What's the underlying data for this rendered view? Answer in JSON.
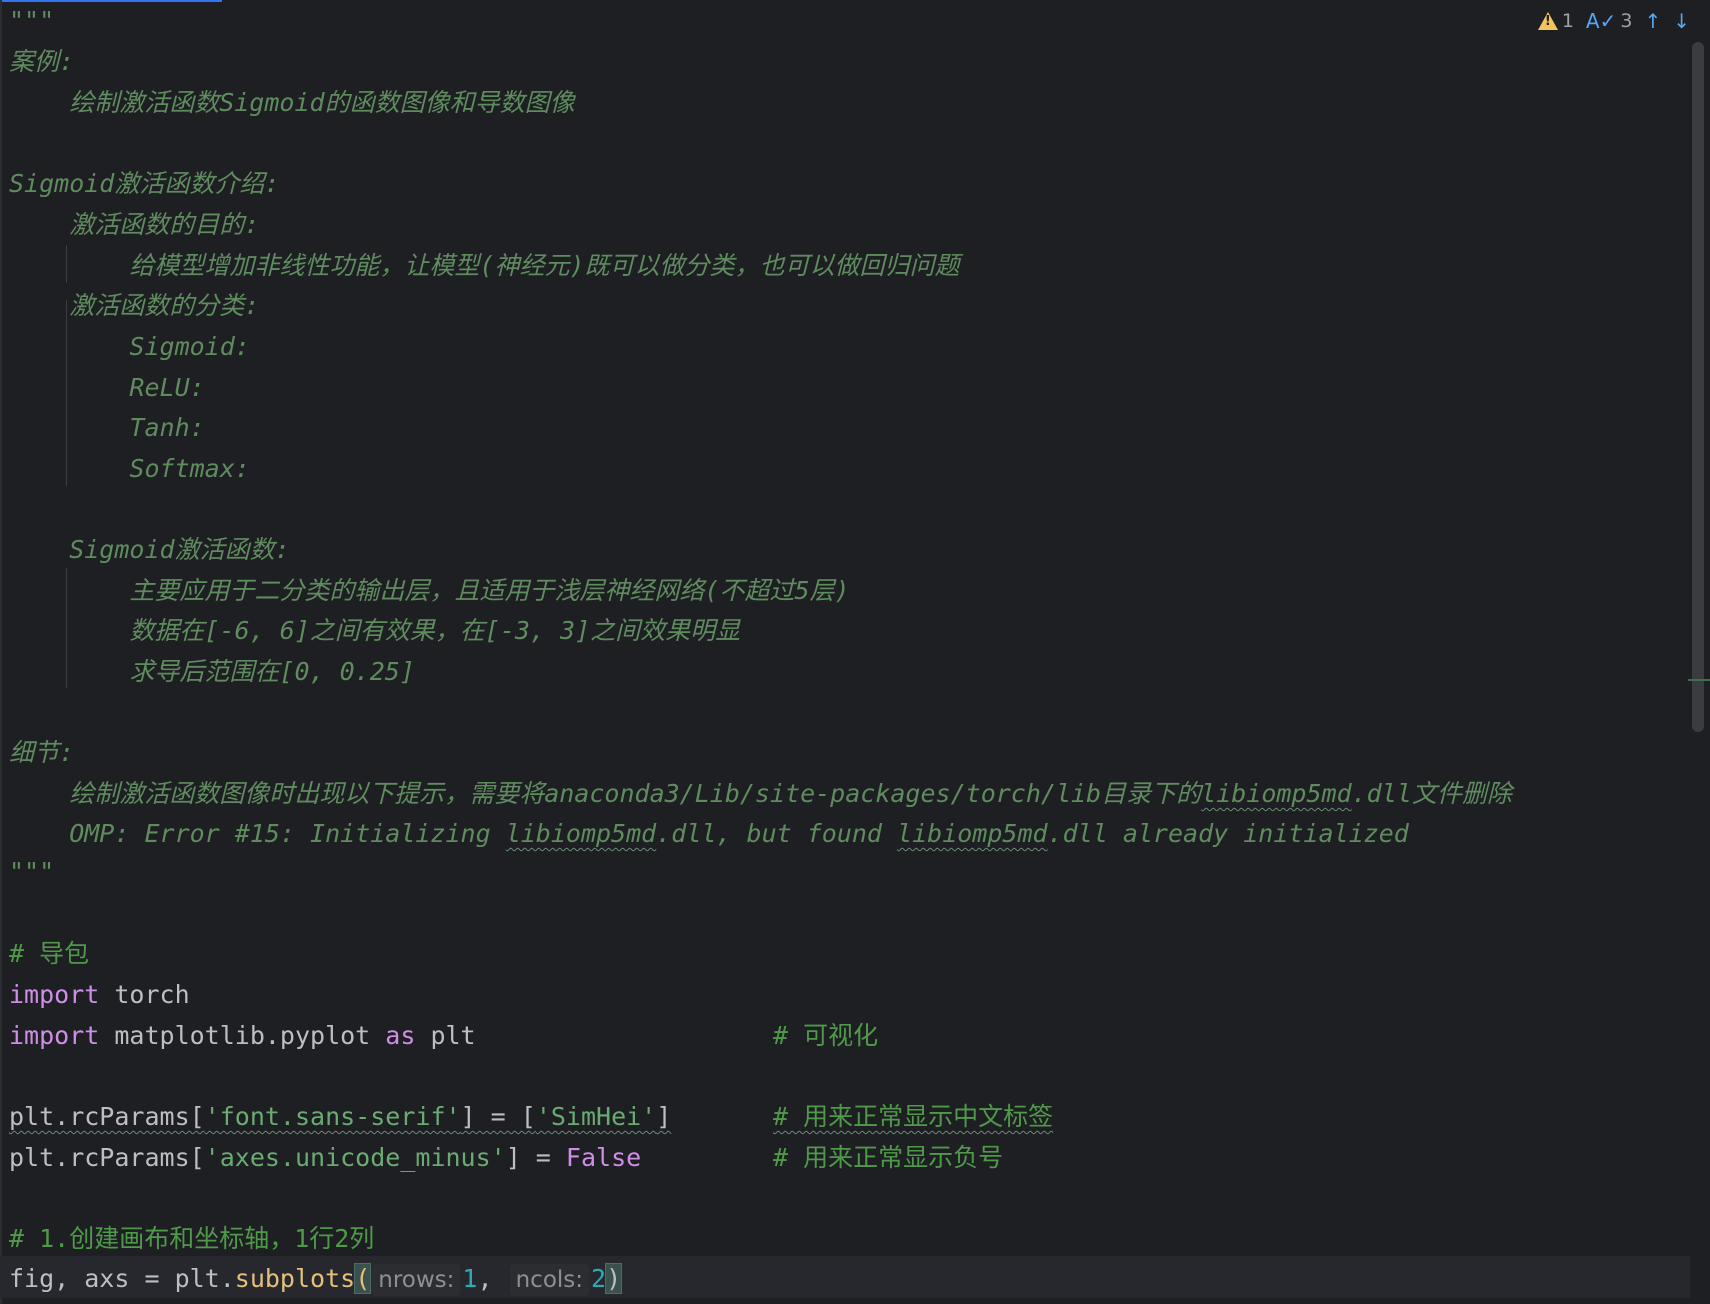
{
  "status": {
    "warning_count": "1",
    "typo_count": "3",
    "prev_label": "↑",
    "next_label": "↓"
  },
  "docstring": {
    "open_quotes": "\"\"\"",
    "l_case": "案例:",
    "l_case_desc": "    绘制激活函数Sigmoid的函数图像和导数图像",
    "l_intro": "Sigmoid激活函数介绍:",
    "l_purpose": "    激活函数的目的:",
    "l_purpose_desc": "        给模型增加非线性功能，让模型(神经元)既可以做分类，也可以做回归问题",
    "l_types": "    激活函数的分类:",
    "l_t1": "        Sigmoid:",
    "l_t2": "        ReLU:",
    "l_t3": "        Tanh:",
    "l_t4": "        Softmax:",
    "l_sig": "    Sigmoid激活函数:",
    "l_s1": "        主要应用于二分类的输出层，且适用于浅层神经网络(不超过5层)",
    "l_s2": "        数据在[-6, 6]之间有效果，在[-3, 3]之间效果明显",
    "l_s3": "        求导后范围在[0, 0.25]",
    "l_detail": "细节:",
    "l_d1_a": "    绘制激活函数图像时出现以下提示，需要将anaconda3/Lib/site-packages/torch/lib目录下的",
    "l_d1_b": "libiomp5md",
    "l_d1_c": ".dll文件删除",
    "l_d2_a": "    OMP: Error #15: Initializing ",
    "l_d2_b": "libiomp5md",
    "l_d2_c": ".dll, but found ",
    "l_d2_d": "libiomp5md",
    "l_d2_e": ".dll already initialized",
    "close_quotes": "\"\"\""
  },
  "code": {
    "c_import_pkg": "# 导包",
    "imp1_kw": "import",
    "imp1_mod": " torch",
    "imp2_kw": "import",
    "imp2_mod": " matplotlib.pyplot ",
    "imp2_as": "as",
    "imp2_alias": " plt",
    "imp2_comment": "# 可视化",
    "rc1_a": "plt.rcParams[",
    "rc1_str": "'font.sans-serif'",
    "rc1_b": "] = [",
    "rc1_str2": "'SimHei'",
    "rc1_c": "]",
    "rc1_comment": "# 用来正常显示中文标签",
    "rc2_a": "plt.rcParams[",
    "rc2_str": "'axes.unicode_minus'",
    "rc2_b": "] = ",
    "rc2_false": "False",
    "rc2_comment": "# 用来正常显示负号",
    "c_step1": "# 1.创建画布和坐标轴，1行2列",
    "sub_a": "fig, axs = plt.",
    "sub_fn": "subplots",
    "sub_open": "(",
    "hint_nrows": "nrows:",
    "sub_n1": "1",
    "sub_comma": ",",
    "hint_ncols": "ncols:",
    "sub_n2": "2",
    "sub_close": ")"
  }
}
